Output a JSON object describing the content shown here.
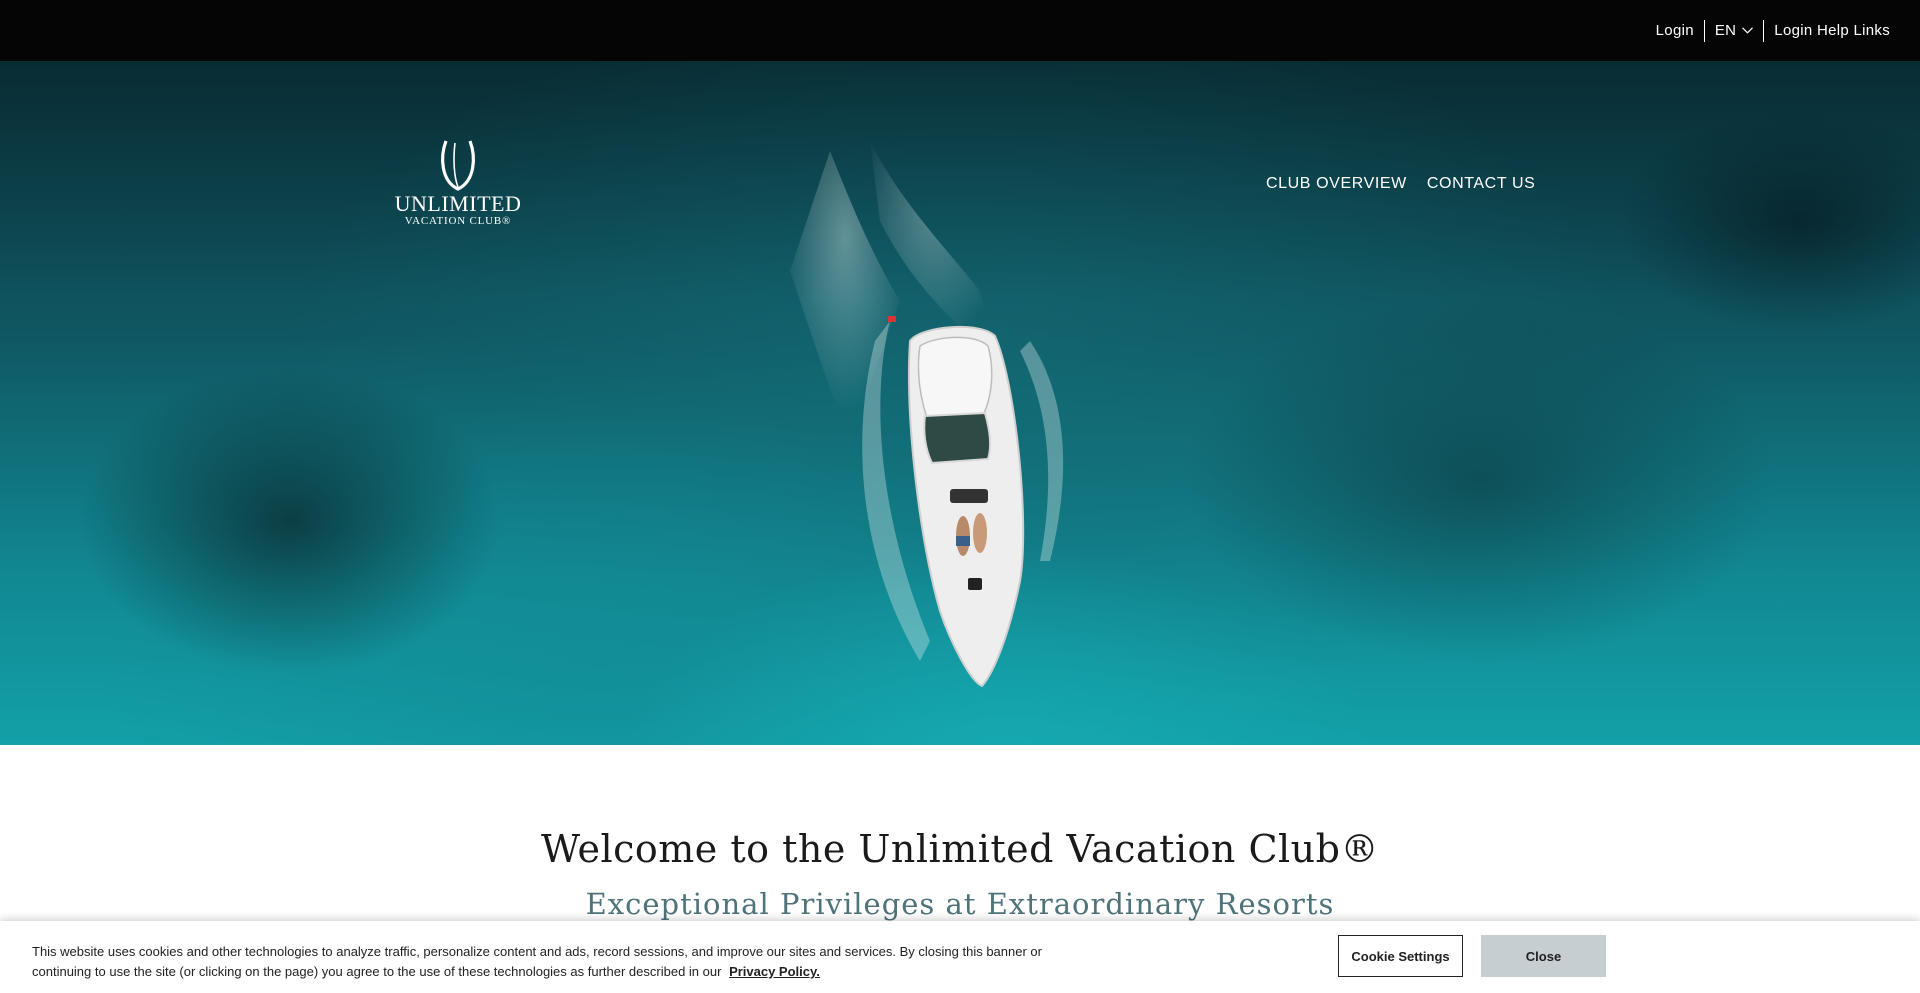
{
  "topbar": {
    "login": "Login",
    "language": "EN",
    "login_help": "Login Help Links"
  },
  "logo": {
    "line1": "UNLIMITED",
    "line2": "VACATION CLUB®"
  },
  "nav": {
    "items": [
      {
        "label": "CLUB OVERVIEW"
      },
      {
        "label": "CONTACT US"
      }
    ]
  },
  "welcome": {
    "title": "Welcome to the Unlimited Vacation Club®",
    "subtitle": "Exceptional Privileges at Extraordinary Resorts"
  },
  "cookie": {
    "message": "This website uses cookies and other technologies to analyze traffic, personalize content and ads, record sessions, and improve our sites and services. By closing this banner or continuing to use the site (or clicking on the page) you agree to the use of these technologies as further described in our",
    "privacy_link": "Privacy Policy.",
    "settings_label": "Cookie Settings",
    "close_label": "Close"
  },
  "colors": {
    "topbar_bg": "#050505",
    "subtitle": "#4e7379",
    "close_button_bg": "#c6ced1"
  }
}
